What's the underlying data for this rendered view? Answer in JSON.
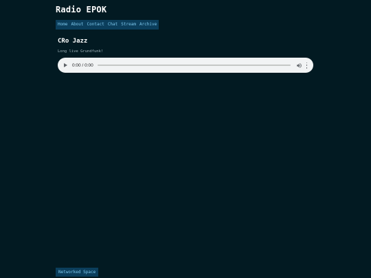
{
  "site": {
    "title": "Radio EPOK"
  },
  "nav": {
    "items": [
      {
        "label": "Home"
      },
      {
        "label": "About"
      },
      {
        "label": "Contact"
      },
      {
        "label": "Chat"
      },
      {
        "label": "Stream"
      },
      {
        "label": "Archive"
      }
    ]
  },
  "station": {
    "name": "CRo Jazz",
    "description": "Long live Grundfunk!"
  },
  "player": {
    "time": "0:00 / 0:00",
    "progress": 0,
    "colors": {
      "background": "#f1f3f4",
      "controls": "#5f6368"
    }
  },
  "footer": {
    "link_label": "Networked Space"
  },
  "colors": {
    "page_background": "#021a22",
    "nav_background": "#0b3e5c",
    "link": "#7ec9ee"
  }
}
